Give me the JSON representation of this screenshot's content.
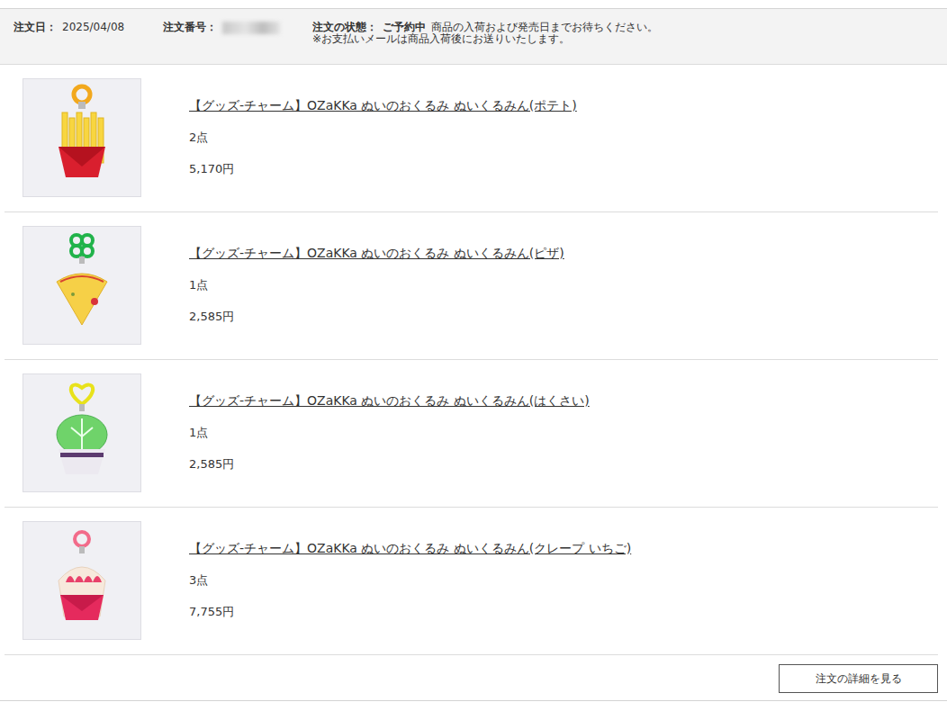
{
  "order": {
    "date_label": "注文日：",
    "date": "2025/04/08",
    "number_label": "注文番号：",
    "status_label": "注文の状態：",
    "status": "ご予約中",
    "status_note": "商品の入荷および発売日までお待ちください。",
    "payment_note": "※お支払いメールは商品入荷後にお送りいたします。"
  },
  "items": [
    {
      "name": "【グッズ-チャーム】OZaKKa ぬいのおくるみ ぬいくるみん(ポテト)",
      "quantity": "2点",
      "price": "5,170円",
      "kind": "potato"
    },
    {
      "name": "【グッズ-チャーム】OZaKKa ぬいのおくるみ ぬいくるみん(ピザ)",
      "quantity": "1点",
      "price": "2,585円",
      "kind": "pizza"
    },
    {
      "name": "【グッズ-チャーム】OZaKKa ぬいのおくるみ ぬいくるみん(はくさい)",
      "quantity": "1点",
      "price": "2,585円",
      "kind": "cabbage"
    },
    {
      "name": "【グッズ-チャーム】OZaKKa ぬいのおくるみ ぬいくるみん(クレープ いちご)",
      "quantity": "3点",
      "price": "7,755円",
      "kind": "crepe"
    }
  ],
  "buttons": [
    "注文の詳細を見る"
  ]
}
